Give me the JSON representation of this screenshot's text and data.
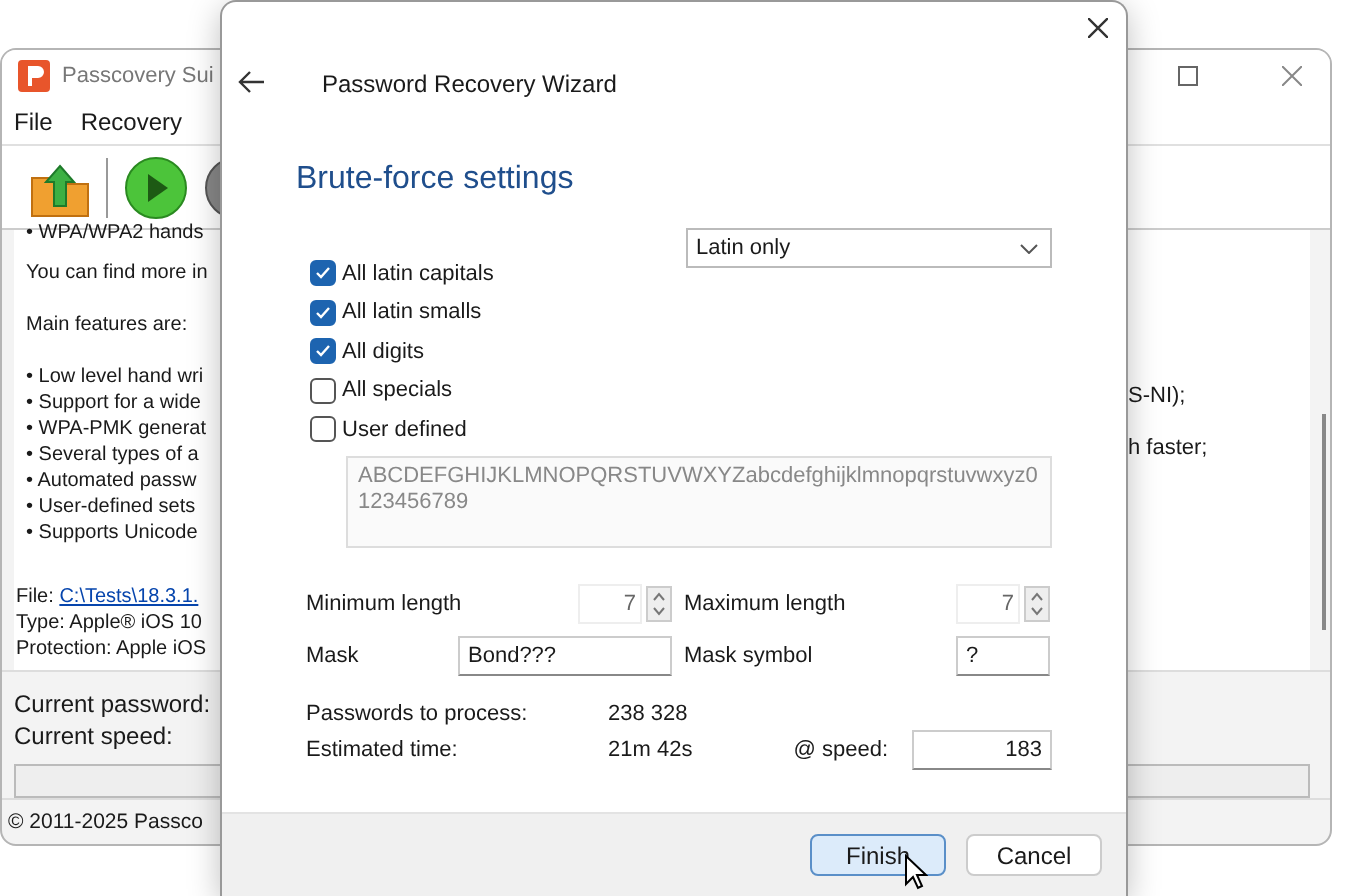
{
  "background_window": {
    "title": "Passcovery Sui",
    "menu": [
      "File",
      "Recovery"
    ],
    "info": [
      {
        "kind": "bullet",
        "text": "• WPA/WPA2 hands"
      },
      {
        "kind": "text",
        "text": "You can find more in"
      },
      {
        "kind": "text",
        "text": "Main features are:"
      },
      {
        "kind": "bullet",
        "text": "• Low level hand wri"
      },
      {
        "kind": "bullet",
        "text": "• Support for a wide"
      },
      {
        "kind": "bullet",
        "text": "• WPA-PMK generat"
      },
      {
        "kind": "bullet",
        "text": "• Several types of a"
      },
      {
        "kind": "bullet",
        "text": "• Automated passw"
      },
      {
        "kind": "bullet",
        "text": "• User-defined sets"
      },
      {
        "kind": "bullet",
        "text": "• Supports Unicode"
      }
    ],
    "right_fragments": [
      "S-NI);",
      "h faster;"
    ],
    "file": {
      "label": "File:",
      "path": "C:\\Tests\\18.3.1."
    },
    "type_line": "Type: Apple® iOS 10",
    "protection_line": "Protection: Apple iOS",
    "status": [
      "Current password:",
      "Current speed:"
    ],
    "progress": {
      "level": 0
    },
    "footer": "© 2011-2025 Passco"
  },
  "dialog": {
    "title": "Password Recovery Wizard",
    "heading": "Brute-force settings",
    "charsets": [
      {
        "label": "All latin capitals",
        "checked": true
      },
      {
        "label": "All latin smalls",
        "checked": true
      },
      {
        "label": "All digits",
        "checked": true
      },
      {
        "label": "All specials",
        "checked": false
      },
      {
        "label": "User defined",
        "checked": false
      }
    ],
    "alphabet": {
      "value": "Latin only"
    },
    "user_chars": {
      "value": "ABCDEFGHIJKLMNOPQRSTUVWXYZabcdefghijklmnopqrstuvwxyz0123456789",
      "disabled": true
    },
    "min_length": {
      "label": "Minimum length",
      "value": "7"
    },
    "max_length": {
      "label": "Maximum length",
      "value": "7"
    },
    "mask": {
      "label": "Mask",
      "value": "Bond???"
    },
    "mask_symbol": {
      "label": "Mask symbol",
      "value": "?"
    },
    "passwords": {
      "label": "Passwords to process:",
      "value": "238 328"
    },
    "estimated": {
      "label": "Estimated time:",
      "value": "21m 42s"
    },
    "speed": {
      "label": "@ speed:",
      "value": "183"
    },
    "buttons": [
      {
        "label": "Finish",
        "kind": "default"
      },
      {
        "label": "Cancel",
        "kind": "normal"
      }
    ]
  }
}
